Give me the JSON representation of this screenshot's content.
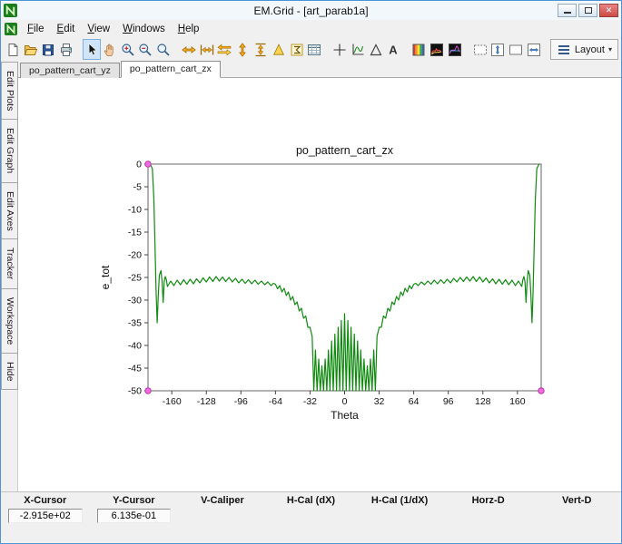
{
  "window": {
    "title": "EM.Grid - [art_parab1a]"
  },
  "menu": {
    "items": [
      "File",
      "Edit",
      "View",
      "Windows",
      "Help"
    ]
  },
  "toolbar": {
    "items": [
      {
        "type": "button",
        "name": "new-document-button",
        "icon": "new-document"
      },
      {
        "type": "button",
        "name": "open-button",
        "icon": "open-folder"
      },
      {
        "type": "button",
        "name": "save-button",
        "icon": "save"
      },
      {
        "type": "button",
        "name": "print-button",
        "icon": "print"
      },
      {
        "type": "sep"
      },
      {
        "type": "button",
        "name": "select-tool-button",
        "icon": "cursor-arrow",
        "selected": true
      },
      {
        "type": "button",
        "name": "pan-tool-button",
        "icon": "pan-hand"
      },
      {
        "type": "button",
        "name": "zoom-in-button",
        "icon": "zoom-in"
      },
      {
        "type": "button",
        "name": "zoom-out-button",
        "icon": "zoom-out"
      },
      {
        "type": "button",
        "name": "zoom-window-button",
        "icon": "zoom"
      },
      {
        "type": "sep"
      },
      {
        "type": "button",
        "name": "fit-x-button",
        "icon": "fit-x"
      },
      {
        "type": "button",
        "name": "fit-x-limits-button",
        "icon": "fit-x-limits"
      },
      {
        "type": "button",
        "name": "swap-axes-button",
        "icon": "swap-h"
      },
      {
        "type": "button",
        "name": "fit-y-button",
        "icon": "fit-y"
      },
      {
        "type": "button",
        "name": "fit-y-limits-button",
        "icon": "fit-y-limits"
      },
      {
        "type": "button",
        "name": "peak-search-button",
        "icon": "peak"
      },
      {
        "type": "button",
        "name": "sum-button",
        "icon": "sigma"
      },
      {
        "type": "button",
        "name": "data-table-button",
        "icon": "table"
      },
      {
        "type": "sep"
      },
      {
        "type": "button",
        "name": "crosshair-button",
        "icon": "crosshair"
      },
      {
        "type": "button",
        "name": "edit-axes-button",
        "icon": "axes-curve"
      },
      {
        "type": "button",
        "name": "caliper-button",
        "icon": "delta"
      },
      {
        "type": "button",
        "name": "text-annotation-button",
        "icon": "text-a"
      },
      {
        "type": "sep"
      },
      {
        "type": "button",
        "name": "colormap-button",
        "icon": "colormap"
      },
      {
        "type": "button",
        "name": "waterfall-button",
        "icon": "waterfall-1"
      },
      {
        "type": "button",
        "name": "spectrogram-button",
        "icon": "waterfall-2"
      },
      {
        "type": "sep"
      },
      {
        "type": "button",
        "name": "frame-dashed-button",
        "icon": "frame-dashed"
      },
      {
        "type": "button",
        "name": "frame-vertical-button",
        "icon": "frame-v"
      },
      {
        "type": "button",
        "name": "frame-plain-button",
        "icon": "frame-plain"
      },
      {
        "type": "button",
        "name": "frame-horizontal-button",
        "icon": "frame-h"
      },
      {
        "type": "sep"
      },
      {
        "type": "dropdown",
        "name": "layout-dropdown",
        "icon": "layout-lines",
        "label": "Layout"
      }
    ]
  },
  "document_tabs": [
    {
      "label": "po_pattern_cart_yz",
      "active": false
    },
    {
      "label": "po_pattern_cart_zx",
      "active": true
    }
  ],
  "sidebar": {
    "tabs": [
      {
        "label": "Edit Plots"
      },
      {
        "label": "Edit Graph"
      },
      {
        "label": "Edit Axes"
      },
      {
        "label": "Tracker"
      },
      {
        "label": "Workspace"
      },
      {
        "label": "Hide"
      }
    ]
  },
  "statusbar": {
    "columns": [
      {
        "label": "X-Cursor",
        "value": "-2.915e+02"
      },
      {
        "label": "Y-Cursor",
        "value": "6.135e-01"
      },
      {
        "label": "V-Caliper",
        "value": ""
      },
      {
        "label": "H-Cal (dX)",
        "value": ""
      },
      {
        "label": "H-Cal (1/dX)",
        "value": ""
      },
      {
        "label": "Horz-D",
        "value": ""
      },
      {
        "label": "Vert-D",
        "value": ""
      }
    ]
  },
  "chart_data": {
    "type": "line",
    "title": "po_pattern_cart_zx",
    "xlabel": "Theta",
    "ylabel": "e_tot",
    "xlim": [
      -182,
      182
    ],
    "ylim": [
      -50,
      0
    ],
    "x_ticks": [
      -160,
      -128,
      -96,
      -64,
      -32,
      0,
      32,
      64,
      96,
      128,
      160
    ],
    "y_ticks": [
      0,
      -5,
      -10,
      -15,
      -20,
      -25,
      -30,
      -35,
      -40,
      -45,
      -50
    ],
    "grid": false,
    "line_color": "#0f8a0f",
    "handle_color": "#f06ae0",
    "series": [
      {
        "name": "e_tot",
        "points": [
          [
            -180,
            0
          ],
          [
            -178,
            -1
          ],
          [
            -176.5,
            -8
          ],
          [
            -175.5,
            -18
          ],
          [
            -174.5,
            -28
          ],
          [
            -173.5,
            -35
          ],
          [
            -172.5,
            -29
          ],
          [
            -171.5,
            -24.5
          ],
          [
            -170,
            -23.5
          ],
          [
            -169,
            -26
          ],
          [
            -168,
            -30.5
          ],
          [
            -167,
            -26
          ],
          [
            -166,
            -24.8
          ],
          [
            -165,
            -25.5
          ],
          [
            -164,
            -27
          ],
          [
            -161,
            -25.8
          ],
          [
            -158,
            -26.8
          ],
          [
            -155,
            -25.6
          ],
          [
            -152,
            -26.6
          ],
          [
            -149,
            -25.5
          ],
          [
            -146,
            -26.5
          ],
          [
            -143,
            -25.4
          ],
          [
            -140,
            -26.4
          ],
          [
            -137,
            -25.3
          ],
          [
            -134,
            -26.2
          ],
          [
            -131,
            -25.1
          ],
          [
            -128,
            -26
          ],
          [
            -125,
            -24.9
          ],
          [
            -122,
            -25.9
          ],
          [
            -119,
            -24.8
          ],
          [
            -116,
            -25.8
          ],
          [
            -113,
            -24.9
          ],
          [
            -110,
            -25.9
          ],
          [
            -107,
            -25
          ],
          [
            -104,
            -26
          ],
          [
            -101,
            -25.2
          ],
          [
            -98,
            -26.2
          ],
          [
            -95,
            -25.4
          ],
          [
            -92,
            -26.3
          ],
          [
            -89,
            -25.5
          ],
          [
            -86,
            -26.4
          ],
          [
            -83,
            -25.6
          ],
          [
            -80,
            -26.5
          ],
          [
            -77,
            -25.8
          ],
          [
            -74,
            -26.6
          ],
          [
            -71,
            -26
          ],
          [
            -68,
            -26.8
          ],
          [
            -66,
            -26.3
          ],
          [
            -64,
            -26.5
          ],
          [
            -62,
            -27.5
          ],
          [
            -60,
            -26.8
          ],
          [
            -58,
            -28.2
          ],
          [
            -56,
            -27.4
          ],
          [
            -54,
            -29
          ],
          [
            -52,
            -28.2
          ],
          [
            -50,
            -30
          ],
          [
            -48,
            -29.2
          ],
          [
            -46,
            -31
          ],
          [
            -44,
            -30.4
          ],
          [
            -42,
            -32.4
          ],
          [
            -40,
            -31.8
          ],
          [
            -38,
            -34
          ],
          [
            -36,
            -33.5
          ],
          [
            -34,
            -36
          ],
          [
            -32,
            -36
          ],
          [
            -30,
            -38
          ],
          [
            -28.5,
            -50
          ],
          [
            -27,
            -41
          ],
          [
            -25.5,
            -50
          ],
          [
            -24,
            -43
          ],
          [
            -22.5,
            -50
          ],
          [
            -21,
            -44.5
          ],
          [
            -19.5,
            -50
          ],
          [
            -18,
            -43
          ],
          [
            -16.5,
            -50
          ],
          [
            -15,
            -41
          ],
          [
            -13.5,
            -50
          ],
          [
            -12,
            -39
          ],
          [
            -10.5,
            -50
          ],
          [
            -9,
            -37.5
          ],
          [
            -7.5,
            -50
          ],
          [
            -6,
            -36
          ],
          [
            -4.5,
            -50
          ],
          [
            -3,
            -34.5
          ],
          [
            -1.5,
            -50
          ],
          [
            0,
            -33
          ],
          [
            1.5,
            -50
          ],
          [
            3,
            -34.5
          ],
          [
            4.5,
            -50
          ],
          [
            6,
            -36
          ],
          [
            7.5,
            -50
          ],
          [
            9,
            -37.5
          ],
          [
            10.5,
            -50
          ],
          [
            12,
            -39
          ],
          [
            13.5,
            -50
          ],
          [
            15,
            -41
          ],
          [
            16.5,
            -50
          ],
          [
            18,
            -43
          ],
          [
            19.5,
            -50
          ],
          [
            21,
            -44.5
          ],
          [
            22.5,
            -50
          ],
          [
            24,
            -43
          ],
          [
            25.5,
            -50
          ],
          [
            27,
            -41
          ],
          [
            28.5,
            -50
          ],
          [
            30,
            -38
          ],
          [
            32,
            -36
          ],
          [
            34,
            -36
          ],
          [
            36,
            -33.5
          ],
          [
            38,
            -34
          ],
          [
            40,
            -31.8
          ],
          [
            42,
            -32.4
          ],
          [
            44,
            -30.4
          ],
          [
            46,
            -31
          ],
          [
            48,
            -29.2
          ],
          [
            50,
            -30
          ],
          [
            52,
            -28.2
          ],
          [
            54,
            -29
          ],
          [
            56,
            -27.4
          ],
          [
            58,
            -28.2
          ],
          [
            60,
            -26.8
          ],
          [
            62,
            -27.5
          ],
          [
            64,
            -26.5
          ],
          [
            66,
            -26.3
          ],
          [
            68,
            -26.8
          ],
          [
            71,
            -26
          ],
          [
            74,
            -26.6
          ],
          [
            77,
            -25.8
          ],
          [
            80,
            -26.5
          ],
          [
            83,
            -25.6
          ],
          [
            86,
            -26.4
          ],
          [
            89,
            -25.5
          ],
          [
            92,
            -26.3
          ],
          [
            95,
            -25.4
          ],
          [
            98,
            -26.2
          ],
          [
            101,
            -25.2
          ],
          [
            104,
            -26
          ],
          [
            107,
            -25
          ],
          [
            110,
            -25.9
          ],
          [
            113,
            -24.9
          ],
          [
            116,
            -25.8
          ],
          [
            119,
            -24.8
          ],
          [
            122,
            -25.9
          ],
          [
            125,
            -24.9
          ],
          [
            128,
            -26
          ],
          [
            131,
            -25.1
          ],
          [
            134,
            -26.2
          ],
          [
            137,
            -25.3
          ],
          [
            140,
            -26.4
          ],
          [
            143,
            -25.4
          ],
          [
            146,
            -26.5
          ],
          [
            149,
            -25.5
          ],
          [
            152,
            -26.6
          ],
          [
            155,
            -25.6
          ],
          [
            158,
            -26.8
          ],
          [
            161,
            -25.8
          ],
          [
            164,
            -27
          ],
          [
            165,
            -25.5
          ],
          [
            166,
            -24.8
          ],
          [
            167,
            -26
          ],
          [
            168,
            -30.5
          ],
          [
            169,
            -26
          ],
          [
            170,
            -23.5
          ],
          [
            171.5,
            -24.5
          ],
          [
            172.5,
            -29
          ],
          [
            173.5,
            -35
          ],
          [
            174.5,
            -28
          ],
          [
            175.5,
            -18
          ],
          [
            176.5,
            -8
          ],
          [
            178,
            -1
          ],
          [
            180,
            0
          ]
        ]
      }
    ]
  }
}
